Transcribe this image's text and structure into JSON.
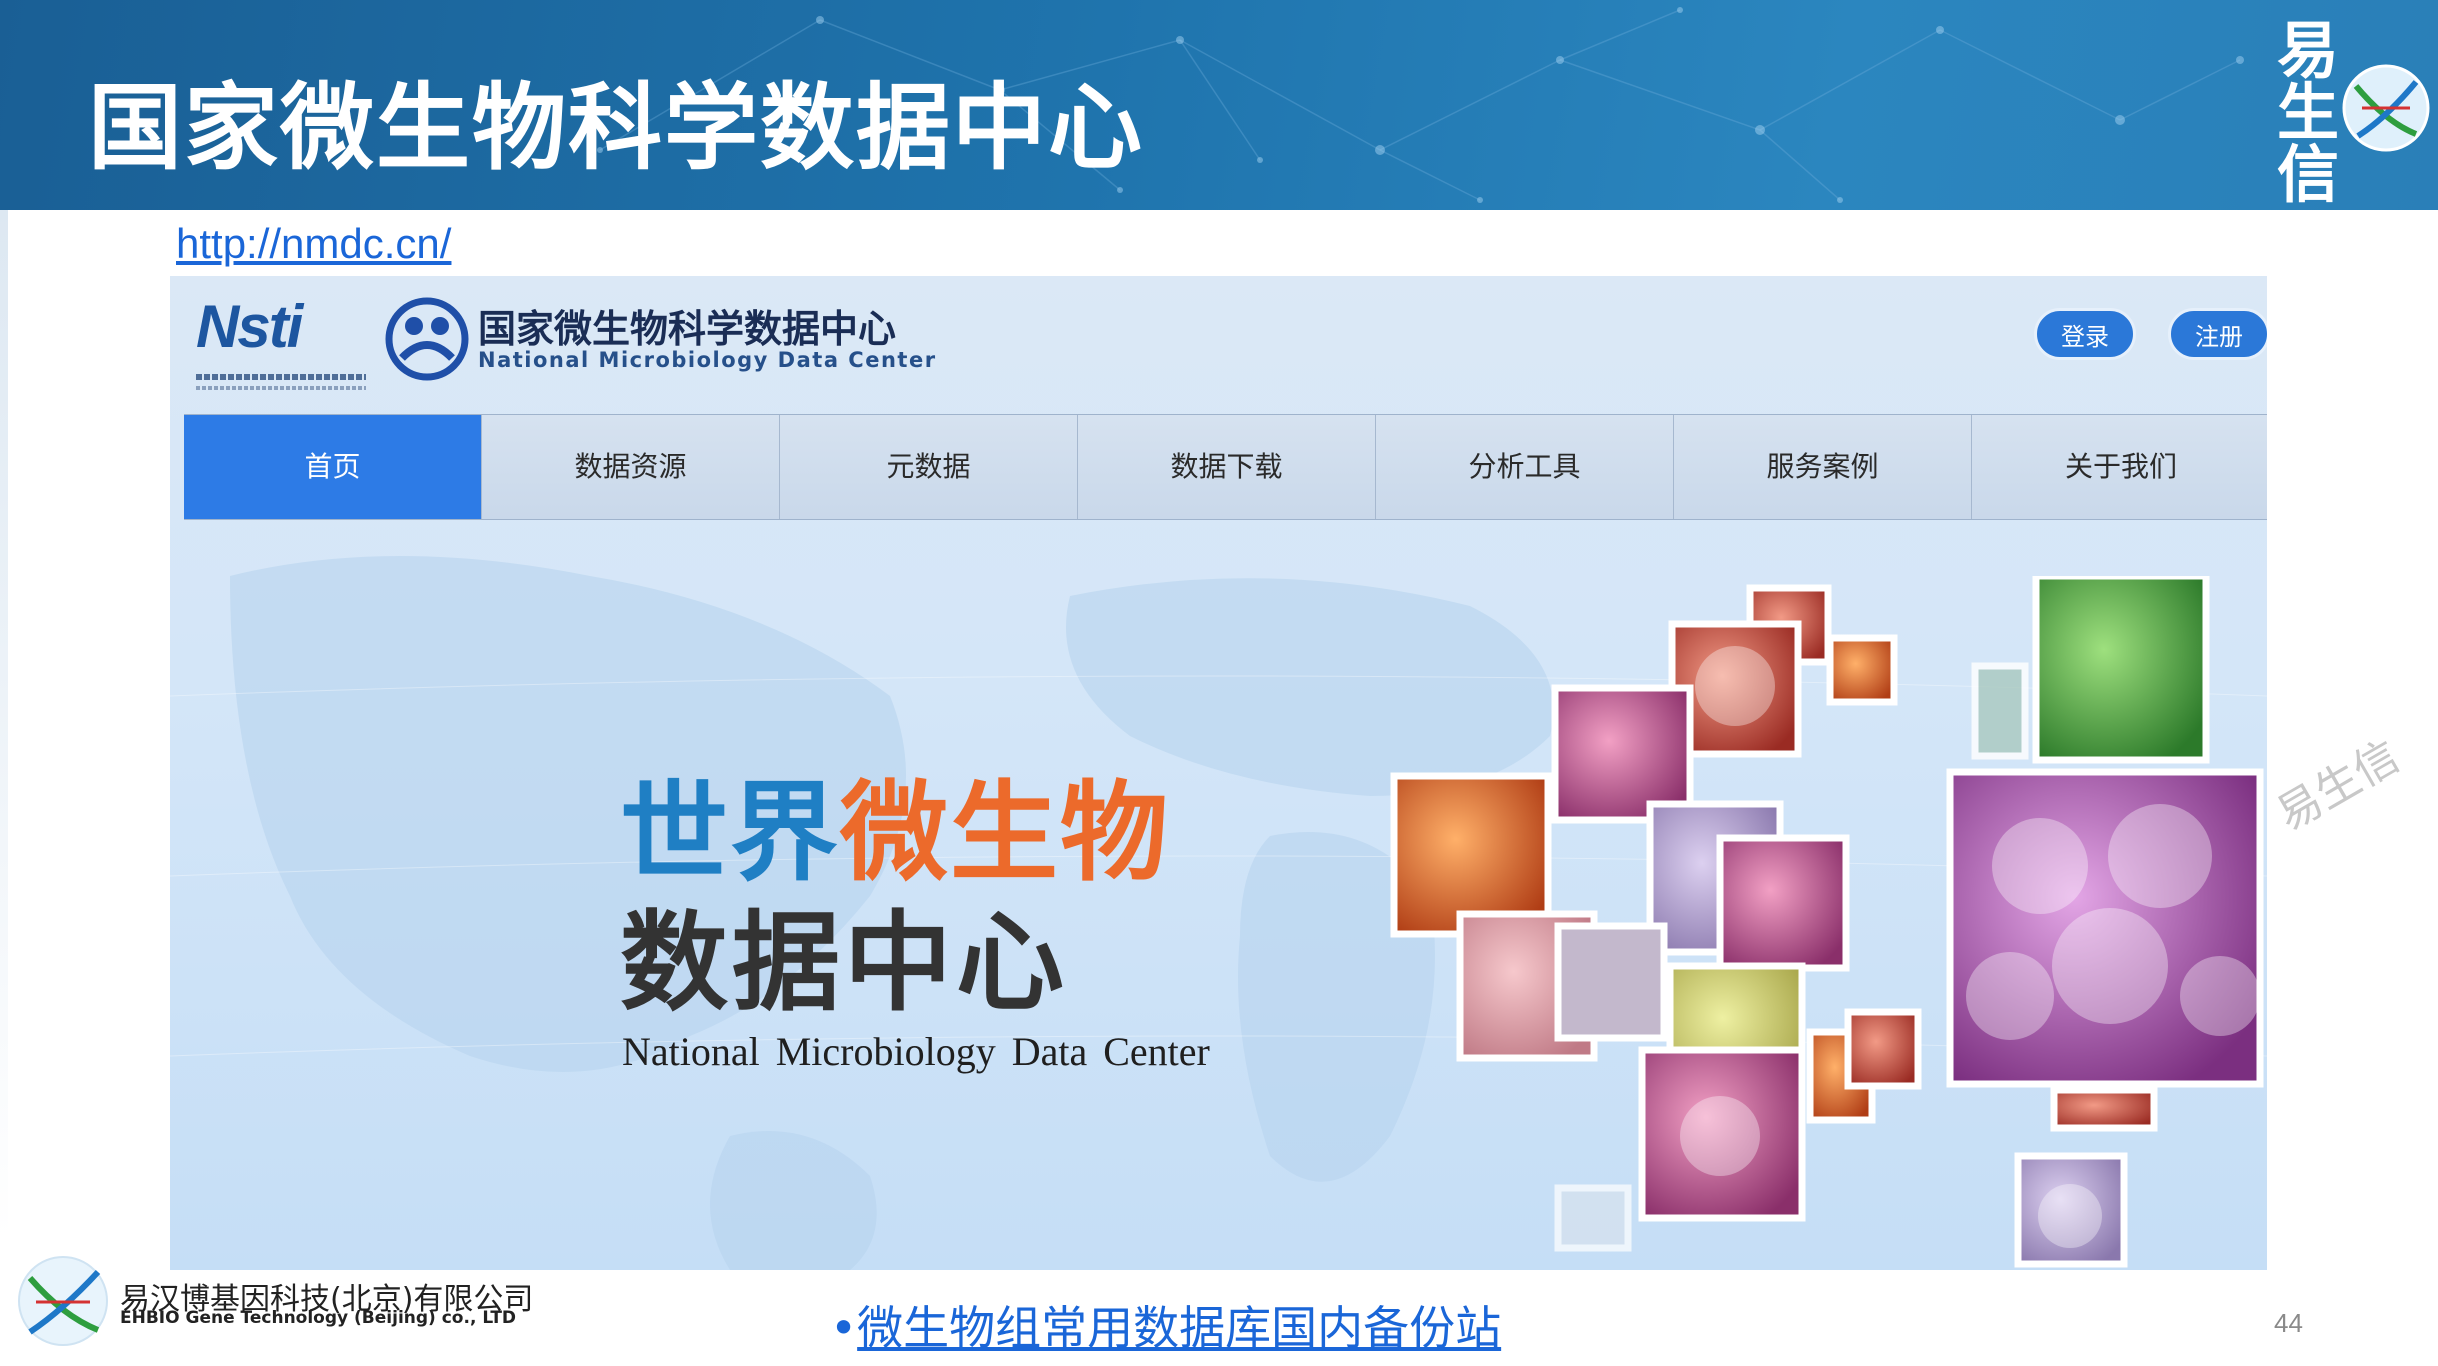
{
  "slide": {
    "title": "国家微生物科学数据中心",
    "brand_vertical": [
      "易",
      "生",
      "信"
    ],
    "url": "http://nmdc.cn/",
    "bullet": "•",
    "bullet_text": "微生物组常用数据库国内备份站",
    "page_number": "44",
    "company_cn": "易汉博基因科技(北京)有限公司",
    "company_en": "EHBIO Gene Technology (Beijing) co., LTD",
    "watermark_text": "易生信"
  },
  "site": {
    "nsti_label": "Nsti",
    "center_name_cn": "国家微生物科学数据中心",
    "center_name_en": "National Microbiology Data Center",
    "login_label": "登录",
    "register_label": "注册",
    "nav": [
      {
        "label": "首页",
        "active": true
      },
      {
        "label": "数据资源",
        "active": false
      },
      {
        "label": "元数据",
        "active": false
      },
      {
        "label": "数据下载",
        "active": false
      },
      {
        "label": "分析工具",
        "active": false
      },
      {
        "label": "服务案例",
        "active": false
      },
      {
        "label": "关于我们",
        "active": false
      }
    ],
    "hero": {
      "line1_blue": "世界",
      "line1_orange": "微生物",
      "line2": "数据中心",
      "english": "National  Microbiology Data Center"
    }
  },
  "colors": {
    "banner_blue": "#1f74ad",
    "nav_active": "#2d7be6",
    "hero_blue": "#1f7fc4",
    "hero_orange": "#ec6a2b",
    "link_blue": "#1a66d8"
  }
}
